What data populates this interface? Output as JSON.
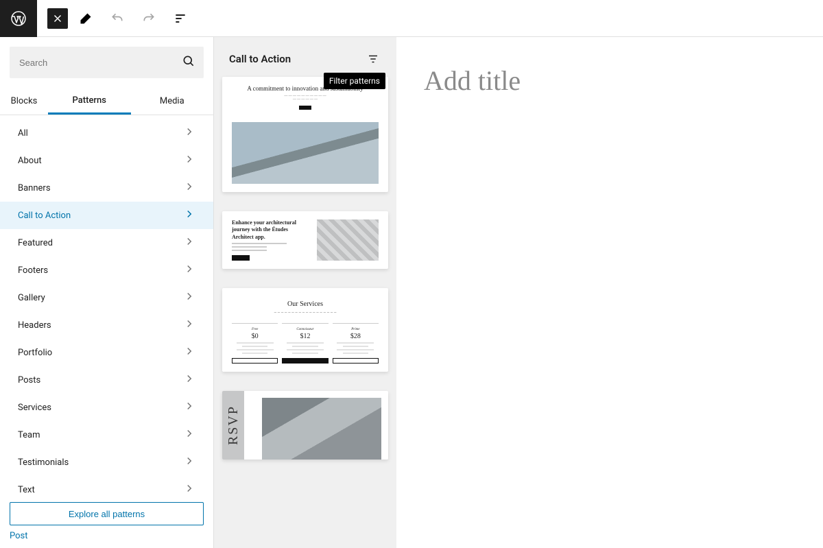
{
  "search": {
    "placeholder": "Search"
  },
  "tabs": {
    "blocks": "Blocks",
    "patterns": "Patterns",
    "media": "Media"
  },
  "categories": [
    {
      "label": "All"
    },
    {
      "label": "About"
    },
    {
      "label": "Banners"
    },
    {
      "label": "Call to Action",
      "active": true
    },
    {
      "label": "Featured"
    },
    {
      "label": "Footers"
    },
    {
      "label": "Gallery"
    },
    {
      "label": "Headers"
    },
    {
      "label": "Portfolio"
    },
    {
      "label": "Posts"
    },
    {
      "label": "Services"
    },
    {
      "label": "Team"
    },
    {
      "label": "Testimonials"
    },
    {
      "label": "Text"
    }
  ],
  "explore_label": "Explore all patterns",
  "post_link": "Post",
  "preview": {
    "title": "Call to Action",
    "filter_tooltip": "Filter patterns"
  },
  "cards": {
    "c1": {
      "heading": "A commitment to innovation and sustainability"
    },
    "c2": {
      "heading": "Enhance your architectural journey with the Études Architect app."
    },
    "c3": {
      "heading": "Our Services",
      "tiers": [
        {
          "name": "Free",
          "price": "$0"
        },
        {
          "name": "Connoisseur",
          "price": "$12"
        },
        {
          "name": "Prime",
          "price": "$28"
        }
      ]
    },
    "c4": {
      "label": "RSVP"
    }
  },
  "canvas": {
    "title_placeholder": "Add title"
  }
}
